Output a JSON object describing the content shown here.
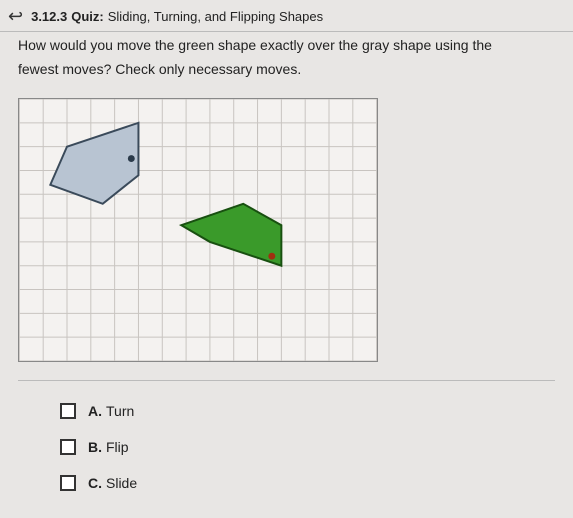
{
  "header": {
    "number": "3.12.3",
    "quiz_label": "Quiz:",
    "title": "Sliding, Turning, and Flipping Shapes"
  },
  "question": {
    "line1": "How would you move the green shape exactly over the gray shape using the",
    "line2": "fewest moves? Check only necessary moves."
  },
  "chart_data": {
    "type": "diagram",
    "grid": {
      "cols": 15,
      "rows": 11,
      "cell": 24
    },
    "shapes": [
      {
        "name": "gray",
        "fill": "#b8c4d2",
        "stroke": "#3a4a5a",
        "vertices": [
          {
            "x": 2,
            "y": 2
          },
          {
            "x": 5,
            "y": 1
          },
          {
            "x": 5,
            "y": 3.2
          },
          {
            "x": 3.5,
            "y": 4.4
          },
          {
            "x": 1.3,
            "y": 3.6
          }
        ],
        "dot": {
          "x": 4.7,
          "y": 2.5,
          "color": "#2a3a4a"
        }
      },
      {
        "name": "green",
        "fill": "#3a9a2a",
        "stroke": "#185010",
        "vertices": [
          {
            "x": 6.8,
            "y": 5.3
          },
          {
            "x": 9.4,
            "y": 4.4
          },
          {
            "x": 11,
            "y": 5.3
          },
          {
            "x": 11,
            "y": 7
          },
          {
            "x": 8,
            "y": 6
          }
        ],
        "dot": {
          "x": 10.6,
          "y": 6.6,
          "color": "#a03010"
        }
      }
    ]
  },
  "options": [
    {
      "letter": "A.",
      "label": "Turn"
    },
    {
      "letter": "B.",
      "label": "Flip"
    },
    {
      "letter": "C.",
      "label": "Slide"
    }
  ]
}
